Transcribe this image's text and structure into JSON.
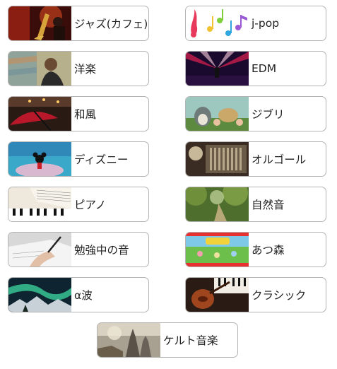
{
  "genres": [
    {
      "label": "ジャズ(カフェ)",
      "icon": "saxophone-icon"
    },
    {
      "label": "j-pop",
      "icon": "music-notes-icon"
    },
    {
      "label": "洋楽",
      "icon": "singer-icon"
    },
    {
      "label": "EDM",
      "icon": "dj-stage-icon"
    },
    {
      "label": "和風",
      "icon": "japanese-umbrella-icon"
    },
    {
      "label": "ジブリ",
      "icon": "ghibli-characters-icon"
    },
    {
      "label": "ディズニー",
      "icon": "disney-character-icon"
    },
    {
      "label": "オルゴール",
      "icon": "music-box-icon"
    },
    {
      "label": "ピアノ",
      "icon": "piano-sheet-icon"
    },
    {
      "label": "自然音",
      "icon": "forest-path-icon"
    },
    {
      "label": "勉強中の音",
      "icon": "studying-hand-icon"
    },
    {
      "label": "あつ森",
      "icon": "animal-crossing-icon"
    },
    {
      "label": "α波",
      "icon": "aurora-icon"
    },
    {
      "label": "クラシック",
      "icon": "violin-piano-icon"
    },
    {
      "label": "ケルト音楽",
      "icon": "celtic-castle-icon"
    }
  ]
}
